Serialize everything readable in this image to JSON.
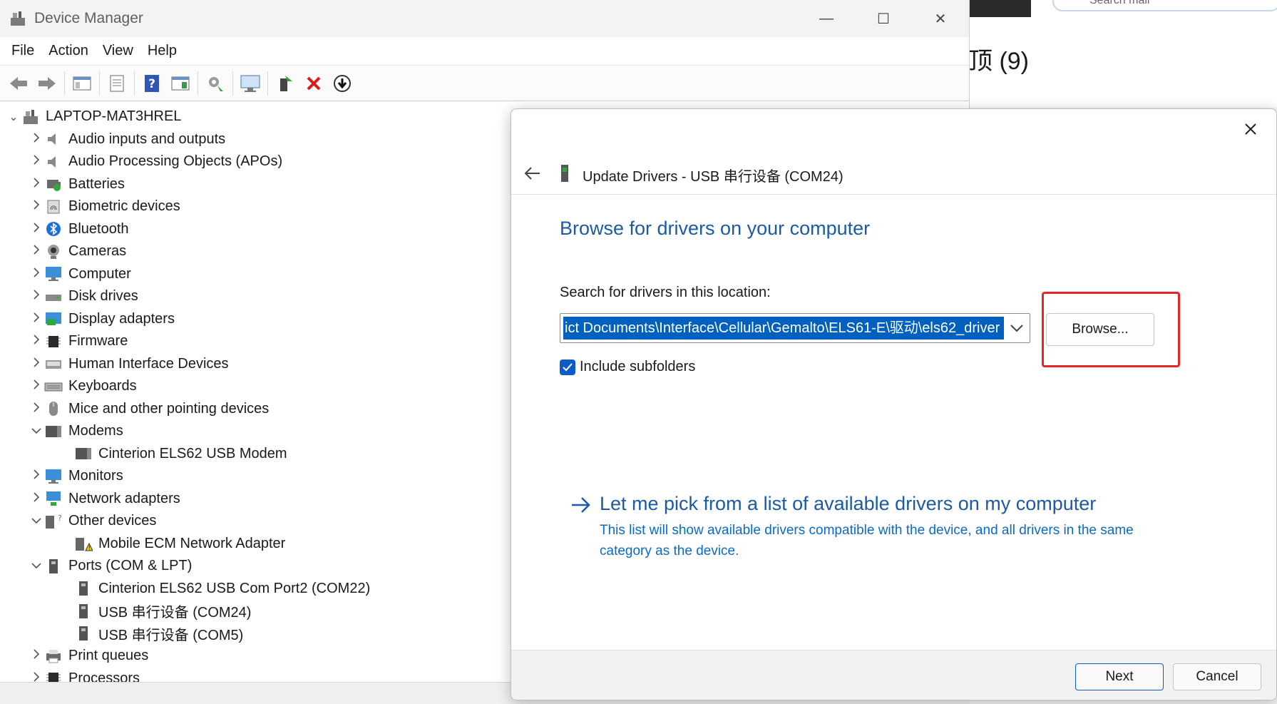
{
  "background": {
    "search_placeholder": "Search mail",
    "heading": "顶 (9)"
  },
  "window": {
    "title": "Device Manager",
    "controls": {
      "minimize": "—",
      "maximize": "☐",
      "close": "✕"
    }
  },
  "menu": [
    "File",
    "Action",
    "View",
    "Help"
  ],
  "tree": {
    "root": "LAPTOP-MAT3HREL",
    "items": [
      {
        "label": "Audio inputs and outputs",
        "icon": "speaker-icon",
        "expanded": false
      },
      {
        "label": "Audio Processing Objects (APOs)",
        "icon": "speaker-icon",
        "expanded": false
      },
      {
        "label": "Batteries",
        "icon": "battery-icon",
        "expanded": false
      },
      {
        "label": "Biometric devices",
        "icon": "fingerprint-icon",
        "expanded": false
      },
      {
        "label": "Bluetooth",
        "icon": "bluetooth-icon",
        "expanded": false
      },
      {
        "label": "Cameras",
        "icon": "camera-icon",
        "expanded": false
      },
      {
        "label": "Computer",
        "icon": "monitor-icon",
        "expanded": false
      },
      {
        "label": "Disk drives",
        "icon": "disk-icon",
        "expanded": false
      },
      {
        "label": "Display adapters",
        "icon": "display-adapter-icon",
        "expanded": false
      },
      {
        "label": "Firmware",
        "icon": "chip-icon",
        "expanded": false
      },
      {
        "label": "Human Interface Devices",
        "icon": "hid-icon",
        "expanded": false
      },
      {
        "label": "Keyboards",
        "icon": "keyboard-icon",
        "expanded": false
      },
      {
        "label": "Mice and other pointing devices",
        "icon": "mouse-icon",
        "expanded": false
      },
      {
        "label": "Modems",
        "icon": "modem-icon",
        "expanded": true,
        "children": [
          "Cinterion ELS62 USB Modem"
        ]
      },
      {
        "label": "Monitors",
        "icon": "monitor-icon",
        "expanded": false
      },
      {
        "label": "Network adapters",
        "icon": "network-icon",
        "expanded": false
      },
      {
        "label": "Other devices",
        "icon": "unknown-device-icon",
        "expanded": true,
        "children": [
          "Mobile ECM Network Adapter"
        ]
      },
      {
        "label": "Ports (COM & LPT)",
        "icon": "port-icon",
        "expanded": true,
        "children": [
          "Cinterion ELS62 USB Com Port2 (COM22)",
          "USB 串行设备 (COM24)",
          "USB 串行设备 (COM5)"
        ]
      },
      {
        "label": "Print queues",
        "icon": "printer-icon",
        "expanded": false
      },
      {
        "label": "Processors",
        "icon": "chip-icon",
        "expanded": false
      }
    ]
  },
  "dialog": {
    "title": "Update Drivers - USB 串行设备 (COM24)",
    "heading": "Browse for drivers on your computer",
    "location_label": "Search for drivers in this location:",
    "path_value": "ict Documents\\Interface\\Cellular\\Gemalto\\ELS61-E\\驱动\\els62_driver",
    "browse_label": "Browse...",
    "include_subfolders_label": "Include subfolders",
    "include_subfolders_checked": true,
    "pick_title": "Let me pick from a list of available drivers on my computer",
    "pick_description": "This list will show available drivers compatible with the device, and all drivers in the same category as the device.",
    "next_label": "Next",
    "cancel_label": "Cancel"
  },
  "colors": {
    "accent_blue": "#1c5aa6",
    "link_blue": "#0b6ac8",
    "selection_blue": "#0060c0",
    "highlight_red": "#e5262a"
  }
}
